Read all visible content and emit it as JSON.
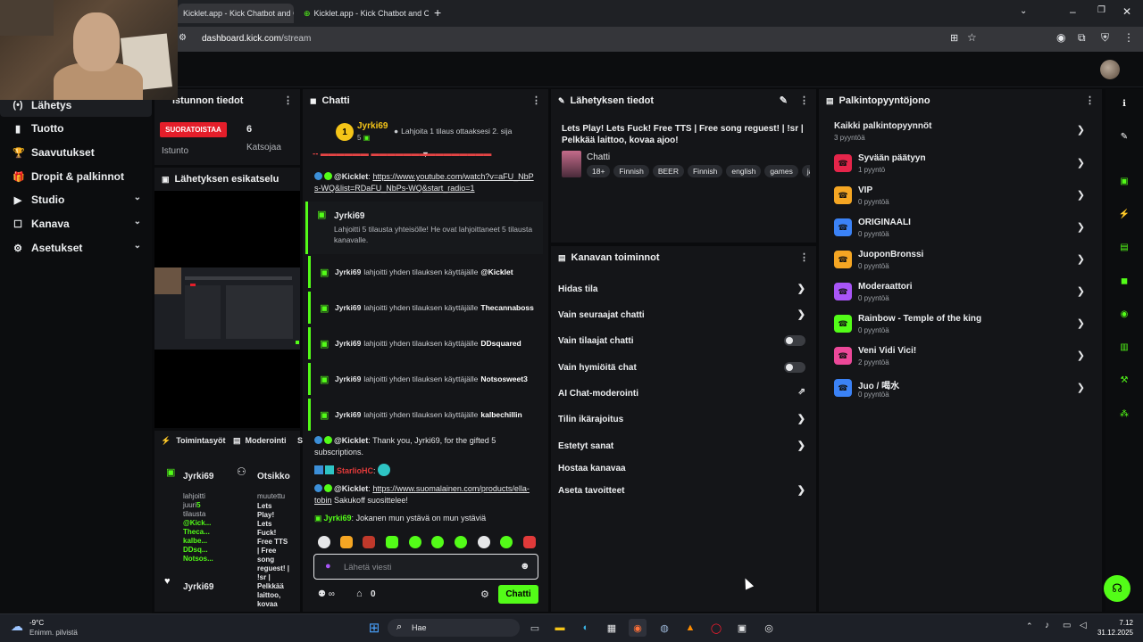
{
  "browser": {
    "tabs": [
      {
        "title": "Kicklet.app - Kick Chatbot and C",
        "close": "✕"
      },
      {
        "title": "Kicklet.app - Kick Chatbot and C",
        "close": "✕"
      }
    ],
    "url_host": "dashboard.kick.com",
    "url_path": "/stream",
    "new_tab": "+"
  },
  "sidebar": {
    "items": [
      {
        "label": "Lähetys",
        "icon": "(•)"
      },
      {
        "label": "Tuotto",
        "icon": "▮"
      },
      {
        "label": "Saavutukset",
        "icon": "🏆"
      },
      {
        "label": "Dropit & palkinnot",
        "icon": "🎁"
      },
      {
        "label": "Studio",
        "icon": "▶"
      },
      {
        "label": "Kanava",
        "icon": "☐"
      },
      {
        "label": "Asetukset",
        "icon": "⚙"
      }
    ]
  },
  "session": {
    "title": "istunnon tiedot",
    "live_badge": "SUORATOISTAA",
    "session_label": "Istunto",
    "viewers_value": "6",
    "viewers_label": "Katsojaa"
  },
  "preview": {
    "title": "Lähetyksen esikatselu"
  },
  "activity": {
    "tab1": "Toimintasyöt",
    "tab2": "Moderointi",
    "tab3": "S",
    "items": [
      {
        "user": "Jyrki69",
        "line1": "lahjoitti",
        "line2": "juuri",
        "count": "5",
        "line3": "tilausta",
        "names": [
          "@Kick...",
          "Theca...",
          "kalbe...",
          "DDsq...",
          "Notsos..."
        ]
      },
      {
        "user": "Jyrki69"
      }
    ],
    "mod": {
      "title": "Otsikko",
      "sub": "muutettu",
      "text": [
        "Lets",
        "Play!",
        "Lets",
        "Fuck!",
        "Free TTS",
        "| Free",
        "song",
        "reguest! |",
        "!sr |",
        "Pelkkää",
        "laittoo,",
        "kovaa"
      ]
    }
  },
  "chat": {
    "title": "Chatti",
    "pinned": {
      "rank": "1",
      "user": "Jyrki69",
      "count": "5",
      "text": "Lahjoita 1 tilaus ottaaksesi 2. sija"
    },
    "msg1_link": "https://www.youtube.com/watch?v=aFU_NbPs-WQ&list=RDaFU_NbPs-WQ&start_radio=1",
    "msg1_user": "@Kicklet",
    "gift_main": {
      "user": "Jyrki69",
      "text": "Lahjoitti 5 tilausta yhteisölle! He ovat lahjoittaneet 5 tilausta kanavalle."
    },
    "gifts": [
      {
        "user": "Jyrki69",
        "text": "lahjoitti yhden tilauksen käyttäjälle",
        "target": "@Kicklet"
      },
      {
        "user": "Jyrki69",
        "text": "lahjoitti yhden tilauksen käyttäjälle",
        "target": "Thecannaboss"
      },
      {
        "user": "Jyrki69",
        "text": "lahjoitti yhden tilauksen käyttäjälle",
        "target": "DDsquared"
      },
      {
        "user": "Jyrki69",
        "text": "lahjoitti yhden tilauksen käyttäjälle",
        "target": "Notsosweet3"
      },
      {
        "user": "Jyrki69",
        "text": "lahjoitti yhden tilauksen käyttäjälle",
        "target": "kalbechillin"
      }
    ],
    "msg_thanks": {
      "user": "@Kicklet",
      "text": "Thank you, Jyrki69, for the gifted 5 subscriptions."
    },
    "msg_starlio": {
      "user": "StarlioHC"
    },
    "msg_link2": {
      "user": "@Kicklet",
      "link": "https://www.suomalainen.com/products/ella-tobin",
      "text": "Sakukoff suosittelee!"
    },
    "msg_last": {
      "user": "Jyrki69",
      "text": "Jokanen mun ystävä on mun ystäviä"
    },
    "input_placeholder": "Lähetä viesti",
    "gift_count": "0",
    "send_label": "Chatti"
  },
  "stream_info": {
    "title": "Lähetyksen tiedot",
    "stream_title": "Lets Play! Lets Fuck! Free TTS | Free song reguest! | !sr | Pelkkää laittoo, kovaa ajoo!",
    "category": "Chatti",
    "tags": [
      "18+",
      "Finnish",
      "BEER",
      "Finnish",
      "english",
      "games",
      "ja"
    ]
  },
  "actions": {
    "title": "Kanavan toiminnot",
    "items": [
      {
        "label": "Hidas tila",
        "control": "chevron"
      },
      {
        "label": "Vain seuraajat chatti",
        "control": "chevron"
      },
      {
        "label": "Vain tilaajat chatti",
        "control": "toggle"
      },
      {
        "label": "Vain hymiöitä chat",
        "control": "toggle"
      },
      {
        "label": "AI Chat-moderointi",
        "control": "external"
      },
      {
        "label": "Tilin ikärajoitus",
        "control": "chevron"
      },
      {
        "label": "Estetyt sanat",
        "control": "chevron"
      },
      {
        "label": "Hostaa kanavaa",
        "control": "none"
      },
      {
        "label": "Aseta tavoitteet",
        "control": "chevron"
      }
    ]
  },
  "rewards": {
    "title": "Palkintopyyntöjono",
    "all_label": "Kaikki palkintopyynnöt",
    "all_count": "3 pyyntöä",
    "items": [
      {
        "name": "Syvään päätyyn",
        "count": "1 pyyntö",
        "color": "#e5254a"
      },
      {
        "name": "VIP",
        "count": "0 pyyntöä",
        "color": "#f5a623"
      },
      {
        "name": "ORIGINAALI",
        "count": "0 pyyntöä",
        "color": "#3b82f6"
      },
      {
        "name": "JuoponBronssi",
        "count": "0 pyyntöä",
        "color": "#f5a623"
      },
      {
        "name": "Moderaattori",
        "count": "0 pyyntöä",
        "color": "#a855f7"
      },
      {
        "name": "Rainbow - Temple of the king",
        "count": "0 pyyntöä",
        "color": "#53fc18"
      },
      {
        "name": "Veni Vidi Vici!",
        "count": "2 pyyntöä",
        "color": "#ec4899"
      },
      {
        "name": "Juo / 喝水",
        "count": "0 pyyntöä",
        "color": "#3b82f6"
      }
    ]
  },
  "taskbar": {
    "weather_temp": "-9°C",
    "weather_desc": "Enimm. pilvistä",
    "search_label": "Hae",
    "time": "7.12",
    "date": "31.12.2025"
  },
  "colors": {
    "accent": "#53fc18",
    "live": "#e41e2a",
    "panel": "#141518"
  }
}
